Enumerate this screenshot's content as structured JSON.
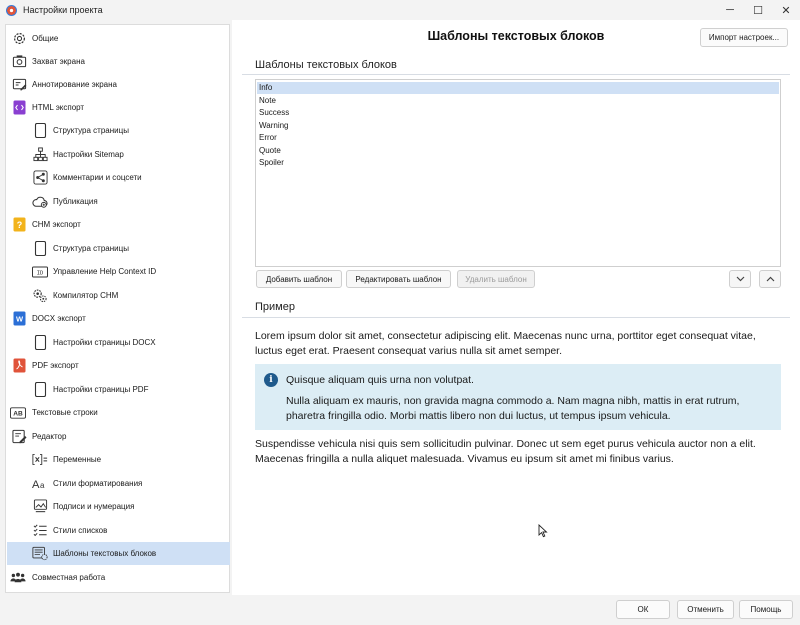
{
  "window": {
    "title": "Настройки проекта",
    "minimize": "─",
    "maximize": "☐",
    "close": "✕"
  },
  "sidebar": {
    "items": [
      {
        "label": "Общие",
        "icon": "gear-icon"
      },
      {
        "label": "Захват экрана",
        "icon": "camera-icon"
      },
      {
        "label": "Аннотирование экрана",
        "icon": "annotate-icon"
      },
      {
        "label": "HTML экспорт",
        "icon": "html-icon"
      },
      {
        "label": "Структура страницы",
        "icon": "page-icon"
      },
      {
        "label": "Настройки Sitemap",
        "icon": "sitemap-icon"
      },
      {
        "label": "Комментарии и соцсети",
        "icon": "share-icon"
      },
      {
        "label": "Публикация",
        "icon": "cloud-icon"
      },
      {
        "label": "CHM экспорт",
        "icon": "chm-icon"
      },
      {
        "label": "Структура страницы",
        "icon": "page-icon"
      },
      {
        "label": "Управление Help Context ID",
        "icon": "context-id-icon"
      },
      {
        "label": "Компилятор CHM",
        "icon": "gears-icon"
      },
      {
        "label": "DOCX экспорт",
        "icon": "docx-icon"
      },
      {
        "label": "Настройки страницы DOCX",
        "icon": "page-icon"
      },
      {
        "label": "PDF экспорт",
        "icon": "pdf-icon"
      },
      {
        "label": "Настройки страницы PDF",
        "icon": "page-icon"
      },
      {
        "label": "Текстовые строки",
        "icon": "ab-icon"
      },
      {
        "label": "Редактор",
        "icon": "editor-icon"
      },
      {
        "label": "Переменные",
        "icon": "variables-icon"
      },
      {
        "label": "Стили форматирования",
        "icon": "font-styles-icon"
      },
      {
        "label": "Подписи и нумерация",
        "icon": "captions-icon"
      },
      {
        "label": "Стили списков",
        "icon": "list-styles-icon"
      },
      {
        "label": "Шаблоны текстовых блоков",
        "icon": "text-block-templates-icon"
      },
      {
        "label": "Совместная работа",
        "icon": "team-icon"
      }
    ],
    "selected_index": 22
  },
  "main": {
    "title": "Шаблоны текстовых блоков",
    "import_button": "Импорт настроек...",
    "templates_section_title": "Шаблоны текстовых блоков",
    "templates": [
      "Info",
      "Note",
      "Success",
      "Warning",
      "Error",
      "Quote",
      "Spoiler"
    ],
    "selected_template": "Info",
    "add_button": "Добавить шаблон",
    "edit_button": "Редактировать шаблон",
    "delete_button": "Удалить шаблон",
    "preview_section_title": "Пример",
    "preview": {
      "paragraph1": "Lorem ipsum dolor sit amet, consectetur adipiscing elit. Maecenas nunc urna, porttitor eget consequat vitae, luctus eget erat. Praesent consequat varius nulla sit amet semper.",
      "info_title": "Quisque aliquam quis urna non volutpat.",
      "info_body": "Nulla aliquam ex mauris, non gravida magna commodo a. Nam magna nibh, mattis in erat rutrum, pharetra fringilla odio. Morbi mattis libero non dui luctus, ut tempus ipsum vehicula.",
      "paragraph2": "Suspendisse vehicula nisi quis sem sollicitudin pulvinar. Donec ut sem eget purus vehicula auctor non a elit. Maecenas fringilla a nulla aliquet malesuada. Vivamus eu ipsum sit amet mi finibus varius."
    }
  },
  "footer": {
    "ok": "ОК",
    "cancel": "Отменить",
    "help": "Помощь"
  },
  "colors": {
    "selection": "#cfe0f5",
    "info_box_bg": "#dcedf5",
    "info_icon": "#1f5a8c",
    "html_badge": "#8a3fd1",
    "chm_badge": "#f2b31b",
    "docx_badge": "#2b6fd6",
    "pdf_badge": "#e0533a"
  }
}
